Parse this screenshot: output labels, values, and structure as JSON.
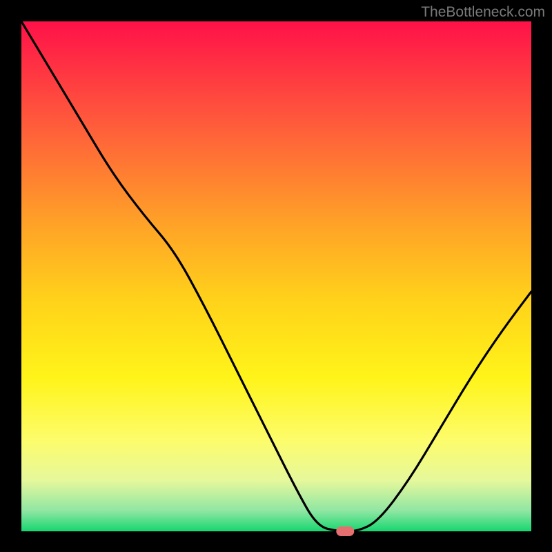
{
  "watermark": "TheBottleneck.com",
  "chart_data": {
    "type": "line",
    "title": "",
    "xlabel": "",
    "ylabel": "",
    "x": [
      0.0,
      0.06,
      0.12,
      0.18,
      0.24,
      0.3,
      0.36,
      0.42,
      0.48,
      0.54,
      0.58,
      0.62,
      0.66,
      0.7,
      0.76,
      0.82,
      0.88,
      0.94,
      1.0
    ],
    "values": [
      1.0,
      0.9,
      0.8,
      0.7,
      0.62,
      0.55,
      0.44,
      0.32,
      0.2,
      0.08,
      0.01,
      0.0,
      0.0,
      0.02,
      0.1,
      0.2,
      0.3,
      0.39,
      0.47
    ],
    "xlim": [
      0,
      1
    ],
    "ylim": [
      0,
      1
    ],
    "marker": {
      "x": 0.635,
      "y": 0.0,
      "color": "#e56f6f"
    },
    "gradient_stops": [
      {
        "offset": 0.0,
        "color": "#ff1149"
      },
      {
        "offset": 0.2,
        "color": "#ff5b3b"
      },
      {
        "offset": 0.4,
        "color": "#ffa327"
      },
      {
        "offset": 0.55,
        "color": "#ffd31a"
      },
      {
        "offset": 0.7,
        "color": "#fff41a"
      },
      {
        "offset": 0.82,
        "color": "#fdfc6a"
      },
      {
        "offset": 0.9,
        "color": "#e6f89b"
      },
      {
        "offset": 0.96,
        "color": "#8fe6a3"
      },
      {
        "offset": 1.0,
        "color": "#17d66f"
      }
    ]
  }
}
